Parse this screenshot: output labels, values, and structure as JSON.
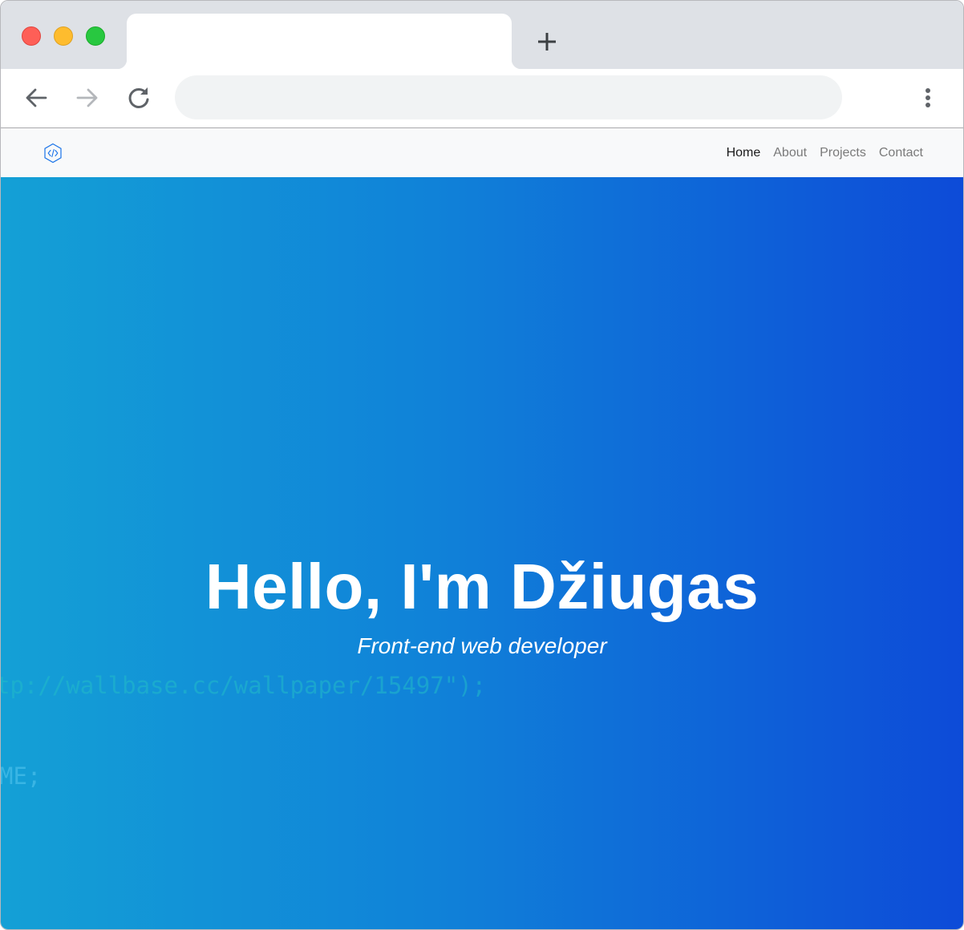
{
  "browser": {
    "tab_title": "",
    "address_bar": {
      "value": "",
      "placeholder": ""
    },
    "icons": {
      "new_tab": "plus-icon",
      "back": "arrow-left-icon",
      "forward": "arrow-right-icon",
      "reload": "reload-icon",
      "menu": "kebab-menu-icon"
    },
    "traffic_lights": {
      "close": "#fe5f57",
      "minimize": "#febc2e",
      "maximize": "#28c840"
    }
  },
  "site": {
    "logo_icon": "code-brackets-hexagon-icon",
    "nav": [
      {
        "label": "Home",
        "active": true
      },
      {
        "label": "About",
        "active": false
      },
      {
        "label": "Projects",
        "active": false
      },
      {
        "label": "Contact",
        "active": false
      }
    ]
  },
  "hero": {
    "title": "Hello, I'm Džiugas",
    "subtitle": "Front-end web developer",
    "background_code": [
      ")",
      "tp://wallbase.cc/wallpaper/15497\");",
      "ME;"
    ],
    "gradient": {
      "start": "#14a0d6",
      "end": "#0d4bd8"
    }
  }
}
